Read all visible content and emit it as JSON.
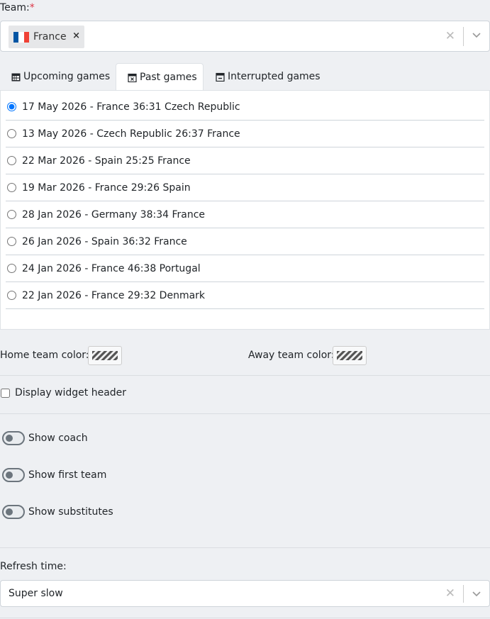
{
  "team": {
    "label": "Team:",
    "required_mark": "*",
    "selected": "France",
    "remove_symbol": "×",
    "clear_symbol": "✕",
    "flag_colors": [
      "#0055a4",
      "#ffffff",
      "#ef4135"
    ]
  },
  "tabs": [
    {
      "label": "Upcoming games",
      "icon": "calendar-icon",
      "active": false
    },
    {
      "label": "Past games",
      "icon": "calendar-x-icon",
      "active": true
    },
    {
      "label": "Interrupted games",
      "icon": "calendar-minus-icon",
      "active": false
    }
  ],
  "games": [
    {
      "text": "17 May 2026 - France 36:31 Czech Republic",
      "selected": true
    },
    {
      "text": "13 May 2026 - Czech Republic 26:37 France",
      "selected": false
    },
    {
      "text": "22 Mar 2026 - Spain 25:25 France",
      "selected": false
    },
    {
      "text": "19 Mar 2026 - France 29:26 Spain",
      "selected": false
    },
    {
      "text": "28 Jan 2026 - Germany 38:34 France",
      "selected": false
    },
    {
      "text": "26 Jan 2026 - Spain 36:32 France",
      "selected": false
    },
    {
      "text": "24 Jan 2026 - France 46:38 Portugal",
      "selected": false
    },
    {
      "text": "22 Jan 2026 - France 29:32 Denmark",
      "selected": false
    }
  ],
  "colors": {
    "home_label": "Home team color:",
    "away_label": "Away team color:"
  },
  "display_header": {
    "label": "Display widget header",
    "checked": false
  },
  "switches": {
    "coach": "Show coach",
    "first_team": "Show first team",
    "substitutes": "Show substitutes"
  },
  "refresh": {
    "label": "Refresh time:",
    "value": "Super slow",
    "clear_symbol": "✕"
  },
  "accent": "#0d6efd"
}
